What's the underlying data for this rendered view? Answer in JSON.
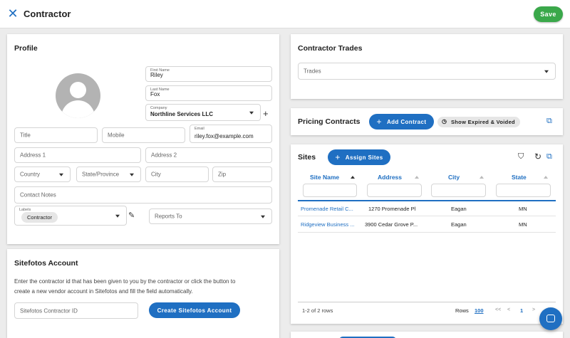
{
  "header": {
    "title": "Contractor",
    "save_label": "Save"
  },
  "profile": {
    "title": "Profile",
    "first_name": {
      "label": "First Name",
      "value": "Riley"
    },
    "last_name": {
      "label": "Last Name",
      "value": "Fox"
    },
    "company": {
      "label": "Company",
      "value": "Northline Services LLC"
    },
    "title_field": "Title",
    "mobile": "Mobile",
    "email": {
      "label": "Email",
      "value": "riley.fox@example.com"
    },
    "address1": "Address 1",
    "address2": "Address 2",
    "country": "Country",
    "state": "State/Province",
    "city": "City",
    "zip": "Zip",
    "contact_notes": "Contact Notes",
    "labels": {
      "label": "Labels",
      "chip": "Contractor"
    },
    "reports_to": "Reports To"
  },
  "sitefotos": {
    "title": "Sitefotos Account",
    "description_line1": "Enter the contractor id that has been given to you by the contractor or click the button to",
    "description_line2": "create a new vendor account in Sitefotos and fill the field automatically.",
    "id_placeholder": "Sitefotos Contractor ID",
    "create_label": "Create Sitefotos Account"
  },
  "trades": {
    "title": "Contractor Trades",
    "placeholder": "Trades"
  },
  "pricing": {
    "title": "Pricing Contracts",
    "add_label": "Add Contract",
    "show_expired_label": "Show Expired & Voided"
  },
  "sites": {
    "title": "Sites",
    "assign_label": "Assign Sites",
    "columns": [
      "Site Name",
      "Address",
      "City",
      "State"
    ],
    "rows": [
      [
        "Promenade Retail C...",
        "1270 Promenade Pl",
        "Eagan",
        "MN"
      ],
      [
        "Ridgeview Business ...",
        "3900 Cedar Grove P...",
        "Eagan",
        "MN"
      ]
    ],
    "footer": {
      "count": "1-2 of 2 rows",
      "rows_label": "Rows",
      "rows_value": "100",
      "first": "<<",
      "prev": "<",
      "page": "1",
      "next": ">"
    }
  },
  "colors": {
    "accent": "#1f6fc2",
    "save": "#3aa84a"
  },
  "icons": [
    "close-icon",
    "add-icon",
    "edit-pencil-icon",
    "open-in-new-icon",
    "filter-off-icon",
    "refresh-icon",
    "chat-icon"
  ]
}
